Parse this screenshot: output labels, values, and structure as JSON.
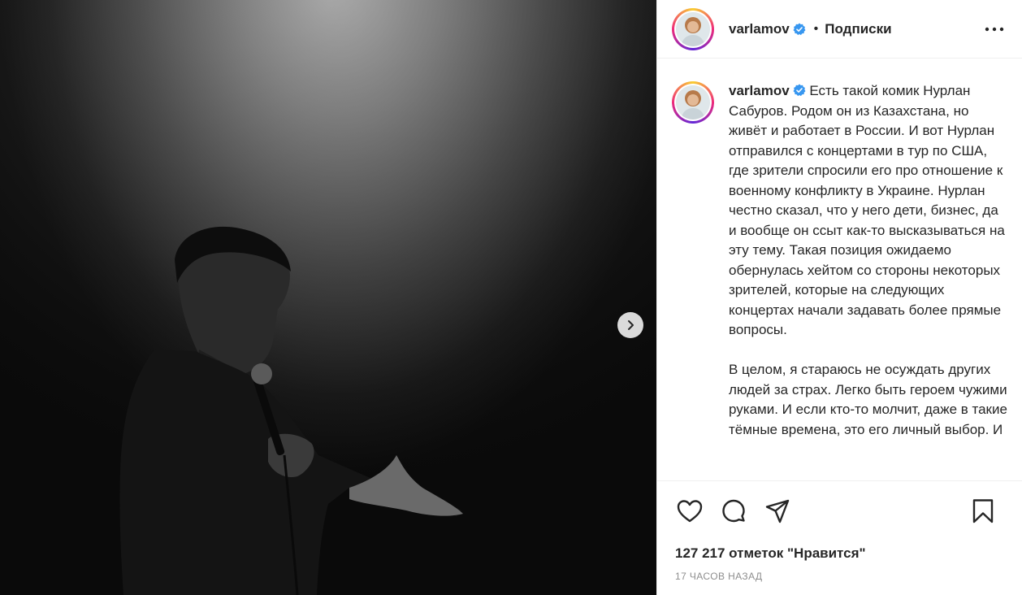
{
  "post": {
    "username": "varlamov",
    "follow_label": "Подписки",
    "separator": "•",
    "caption_paragraph_1": "Есть такой комик Нурлан Сабуров. Родом он из Казахстана, но живёт и работает в России. И вот Нурлан отправился с концертами в тур по США, где зрители спросили его про отношение к военному конфликту в Украине. Нурлан честно сказал, что у него дети, бизнес, да и вообще он ссыт как-то высказываться на эту тему. Такая позиция ожидаемо обернулась хейтом со стороны некоторых зрителей, которые на следующих концертах начали задавать более прямые вопросы.",
    "caption_paragraph_2": "В целом, я стараюсь не осуждать других людей за страх. Легко быть героем чужими руками. И если кто-то молчит, даже в такие тёмные времена, это его личный выбор. И",
    "likes": "127 217 отметок \"Нравится\"",
    "timestamp": "17 ЧАСОВ НАЗАД"
  },
  "icons": {
    "verified": "verified-badge-icon",
    "more": "more-options-icon",
    "next": "chevron-right-icon",
    "like": "heart-icon",
    "comment": "comment-icon",
    "share": "share-icon",
    "save": "bookmark-icon"
  },
  "colors": {
    "verified": "#3897f0",
    "text": "#262626",
    "muted": "#8e8e8e",
    "divider": "#efefef"
  }
}
